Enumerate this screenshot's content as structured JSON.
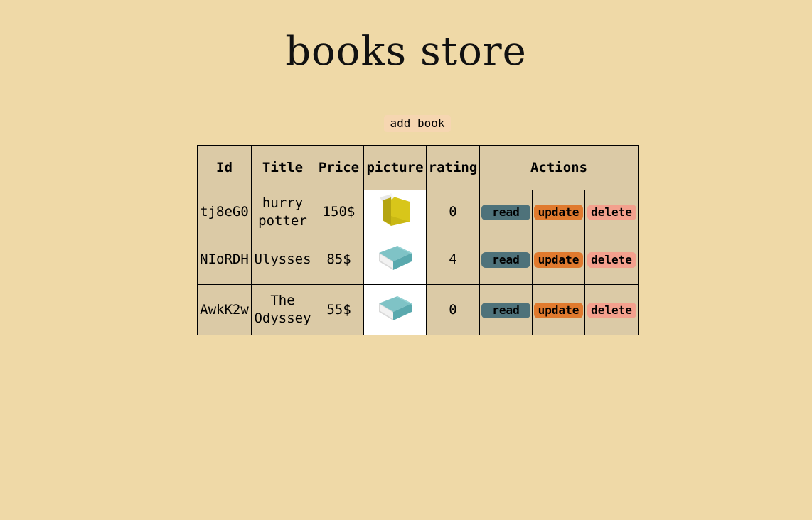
{
  "page": {
    "title": "books store",
    "add_button": "add book"
  },
  "table": {
    "headers": {
      "id": "Id",
      "title": "Title",
      "price": "Price",
      "picture": "picture",
      "rating": "rating",
      "actions": "Actions"
    },
    "rows": [
      {
        "id": "tj8eG0",
        "title_line1": "hurry",
        "title_line2": "potter",
        "price": "150$",
        "picture": "yellow-book-icon",
        "rating": "0"
      },
      {
        "id": "NIoRDH",
        "title_line1": "Ulysses",
        "title_line2": "",
        "price": "85$",
        "picture": "teal-book-icon",
        "rating": "4"
      },
      {
        "id": "AwkK2w",
        "title_line1": "The",
        "title_line2": "Odyssey",
        "price": "55$",
        "picture": "teal-book-icon",
        "rating": "0"
      }
    ],
    "actions": {
      "read": "read",
      "update": "update",
      "delete": "delete"
    }
  },
  "colors": {
    "background": "#efd9a7",
    "table_bg": "#dbcaa6",
    "read": "#4e727a",
    "update": "#e07a2e",
    "delete": "#f3a08d",
    "add_button": "#f6d6b1"
  }
}
